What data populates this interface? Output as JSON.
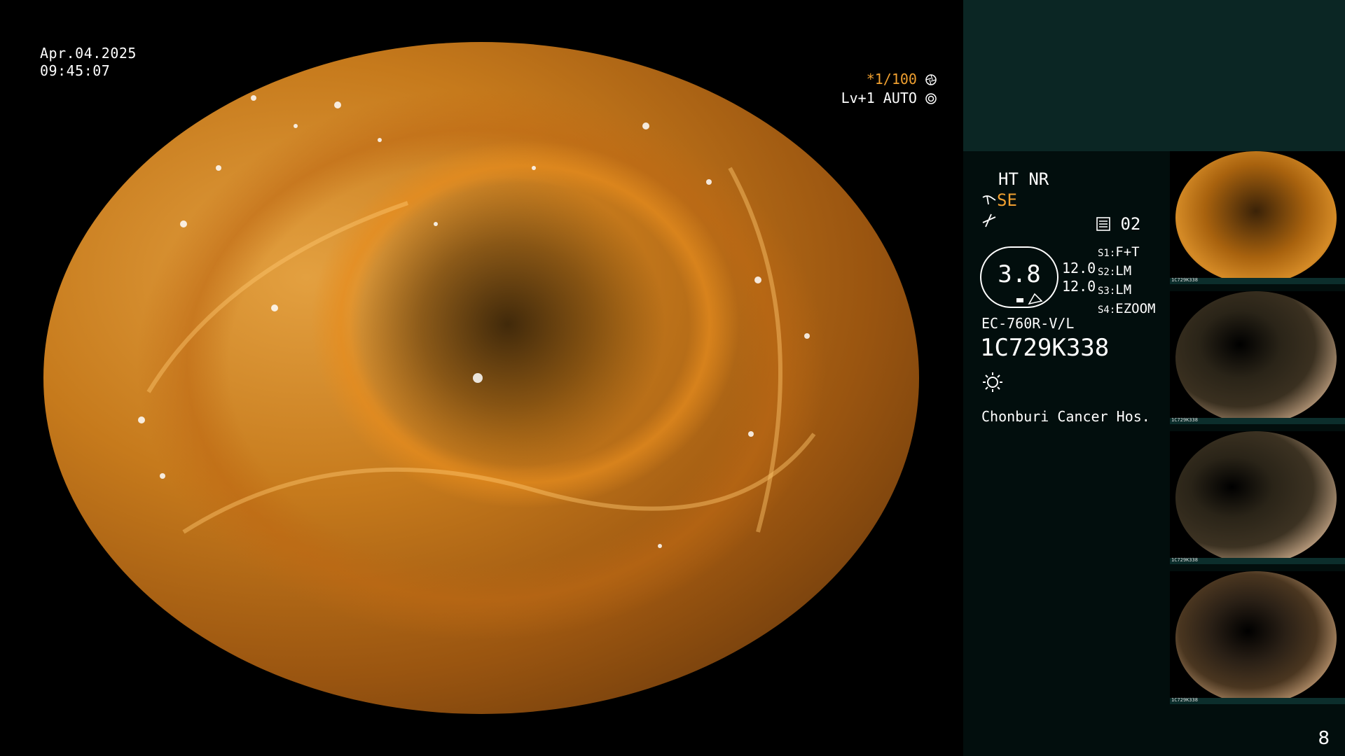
{
  "overlay": {
    "date": "Apr.04.2025",
    "time": "09:45:07",
    "shutter": "*1/100",
    "shutter_icon": "aperture-icon",
    "level": "Lv+1 AUTO",
    "level_icon": "exposure-icon"
  },
  "panel": {
    "mode": "HT NR",
    "se_label": "SE",
    "preset_number": "02",
    "dial_value": "3.8",
    "param_top": "12.0",
    "param_bottom": "12.0",
    "switches": [
      {
        "key": "S1:",
        "value": "F+T"
      },
      {
        "key": "S2:",
        "value": "LM"
      },
      {
        "key": "S3:",
        "value": "LM"
      },
      {
        "key": "S4:",
        "value": "EZOOM"
      }
    ],
    "scope_model": "EC-760R-V/L",
    "scope_serial": "1C729K338",
    "light_icon": "light-source-icon",
    "hospital": "Chonburi Cancer Hos."
  },
  "thumbnails": [
    {
      "caption": "1C729K338"
    },
    {
      "caption": "1C729K338"
    },
    {
      "caption": "1C729K338"
    },
    {
      "caption": "1C729K338"
    }
  ],
  "page_number": "8",
  "colors": {
    "accent_orange": "#f0a030",
    "panel_bg": "#020e0d",
    "teal_box": "#0b2624"
  }
}
